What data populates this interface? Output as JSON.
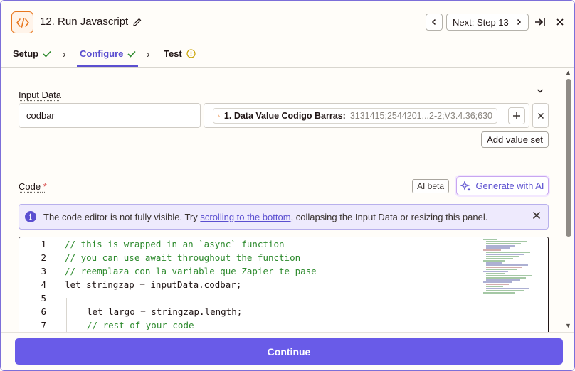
{
  "header": {
    "step_title": "12. Run Javascript",
    "next_label": "Next: Step 13"
  },
  "steps": [
    {
      "label": "Setup",
      "status": "check"
    },
    {
      "label": "Configure",
      "status": "check"
    },
    {
      "label": "Test",
      "status": "warning"
    }
  ],
  "input_data": {
    "label": "Input Data",
    "key_value": "codbar",
    "value_pill_name": "1. Data Value Codigo Barras:",
    "value_pill_sample": "3131415;2544201...2-2;V3.4.36;630",
    "add_value_set": "Add value set"
  },
  "code": {
    "label": "Code",
    "required_mark": "*",
    "ai_beta": "AI beta",
    "generate_ai": "Generate with AI",
    "notice_prefix": "The code editor is not fully visible. Try ",
    "notice_link": "scrolling to the bottom",
    "notice_suffix": ", collapsing the Input Data or resizing this panel.",
    "lines": [
      {
        "n": "1",
        "text": "// this is wrapped in an `async` function",
        "kind": "comment",
        "indent": 0
      },
      {
        "n": "2",
        "text": "// you can use await throughout the function",
        "kind": "comment",
        "indent": 0
      },
      {
        "n": "3",
        "text": "// reemplaza con la variable que Zapier te pase",
        "kind": "comment",
        "indent": 0
      },
      {
        "n": "4",
        "text": "let stringzap = inputData.codbar;",
        "kind": "code",
        "indent": 0
      },
      {
        "n": "5",
        "text": "",
        "kind": "code",
        "indent": 0
      },
      {
        "n": "6",
        "text": "let largo = stringzap.length;",
        "kind": "code",
        "indent": 1
      },
      {
        "n": "7",
        "text": "// rest of your code",
        "kind": "comment",
        "indent": 1
      }
    ]
  },
  "footer": {
    "continue_label": "Continue"
  },
  "colors": {
    "accent": "#695be8",
    "brand_orange": "#e8761d",
    "check_green": "#2d8a2d",
    "warning_yellow": "#c9a300"
  }
}
